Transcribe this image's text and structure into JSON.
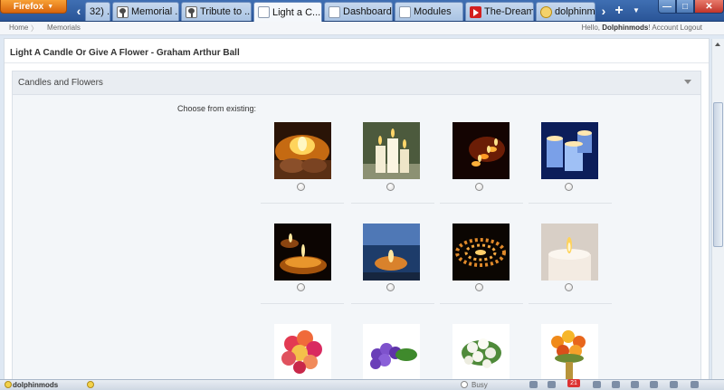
{
  "browser": {
    "menu_label": "Firefox",
    "tabs": [
      {
        "title": "32) ...",
        "icon": "page-icon"
      },
      {
        "title": "Memorial ...",
        "icon": "tree-icon"
      },
      {
        "title": "Tribute to ...",
        "icon": "tree-icon"
      },
      {
        "title": "Light a C...",
        "icon": "page-icon",
        "active": true
      },
      {
        "title": "Dashboard",
        "icon": "page-icon"
      },
      {
        "title": "Modules",
        "icon": "page-icon"
      },
      {
        "title": "The-Dream ...",
        "icon": "youtube-icon"
      },
      {
        "title": "dolphinmo...",
        "icon": "dolphin-icon"
      }
    ],
    "close_glyph": "✕",
    "new_tab_glyph": "+",
    "scroll_left_glyph": "‹",
    "scroll_right_glyph": "›",
    "dropdown_glyph": "▼",
    "min_glyph": "—",
    "max_glyph": "□",
    "win_close_glyph": "✕"
  },
  "breadcrumb": {
    "home": "Home",
    "separator": "〉",
    "memorials": "Memorials"
  },
  "account": {
    "greeting": "Hello, ",
    "username": "Dolphinmods",
    "separator": "! ",
    "links": "Account Logout"
  },
  "page": {
    "title": "Light A Candle Or Give A Flower - Graham Arthur Ball",
    "panel_title": "Candles and Flowers",
    "choose_label": "Choose from existing:"
  },
  "images": [
    {
      "row": 0,
      "col": 0,
      "subject": "candle-in-hands"
    },
    {
      "row": 0,
      "col": 1,
      "subject": "three-white-candles"
    },
    {
      "row": 0,
      "col": 2,
      "subject": "small-candles-dark"
    },
    {
      "row": 0,
      "col": 3,
      "subject": "blue-candles"
    },
    {
      "row": 1,
      "col": 0,
      "subject": "two-candles-dark"
    },
    {
      "row": 1,
      "col": 1,
      "subject": "candle-by-sea"
    },
    {
      "row": 1,
      "col": 2,
      "subject": "candle-spiral"
    },
    {
      "row": 1,
      "col": 3,
      "subject": "single-white-candle"
    },
    {
      "row": 2,
      "col": 0,
      "subject": "rose-bouquet"
    },
    {
      "row": 2,
      "col": 1,
      "subject": "violets"
    },
    {
      "row": 2,
      "col": 2,
      "subject": "white-bouquet"
    },
    {
      "row": 2,
      "col": 3,
      "subject": "orange-bouquet"
    }
  ],
  "statusbar": {
    "user": "dolphinmods",
    "status": "Busy",
    "badge": "21"
  },
  "colors": {
    "tabbar": "#2a5597",
    "firefox_button": "#e5791c",
    "panel_bg": "#f3f6f9",
    "page_bg": "#dfe8f3"
  }
}
